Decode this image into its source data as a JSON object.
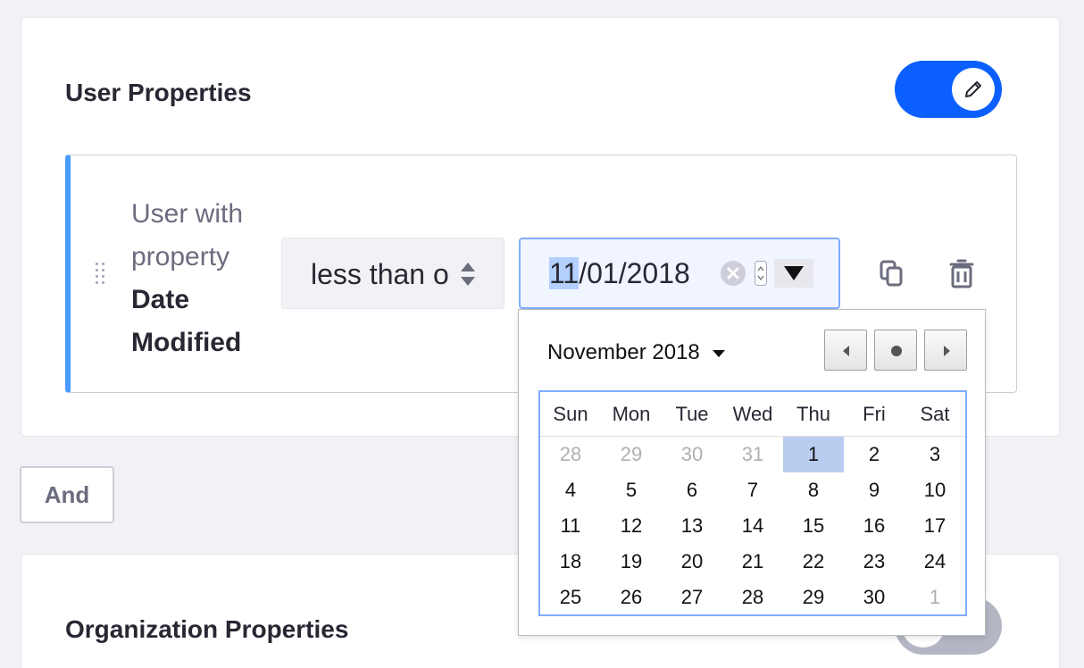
{
  "user_panel": {
    "title": "User Properties",
    "toggle_on": true,
    "criteria": {
      "description_prefix": "User with property",
      "property_name": "Date Modified",
      "operator_value": "less than or equal to",
      "date_value": {
        "month": "11",
        "rest": "/01/2018"
      }
    }
  },
  "conjunction_label": "And",
  "org_panel": {
    "title": "Organization Properties",
    "toggle_on": false
  },
  "datepicker": {
    "month_label": "November 2018",
    "weekdays": [
      "Sun",
      "Mon",
      "Tue",
      "Wed",
      "Thu",
      "Fri",
      "Sat"
    ],
    "weeks": [
      [
        {
          "d": "28",
          "o": true
        },
        {
          "d": "29",
          "o": true
        },
        {
          "d": "30",
          "o": true
        },
        {
          "d": "31",
          "o": true
        },
        {
          "d": "1",
          "s": true
        },
        {
          "d": "2"
        },
        {
          "d": "3"
        }
      ],
      [
        {
          "d": "4"
        },
        {
          "d": "5"
        },
        {
          "d": "6"
        },
        {
          "d": "7"
        },
        {
          "d": "8"
        },
        {
          "d": "9"
        },
        {
          "d": "10"
        }
      ],
      [
        {
          "d": "11"
        },
        {
          "d": "12"
        },
        {
          "d": "13"
        },
        {
          "d": "14"
        },
        {
          "d": "15"
        },
        {
          "d": "16"
        },
        {
          "d": "17"
        }
      ],
      [
        {
          "d": "18"
        },
        {
          "d": "19"
        },
        {
          "d": "20"
        },
        {
          "d": "21"
        },
        {
          "d": "22"
        },
        {
          "d": "23"
        },
        {
          "d": "24"
        }
      ],
      [
        {
          "d": "25"
        },
        {
          "d": "26"
        },
        {
          "d": "27"
        },
        {
          "d": "28"
        },
        {
          "d": "29"
        },
        {
          "d": "30"
        },
        {
          "d": "1",
          "o": true
        }
      ]
    ]
  },
  "colors": {
    "accent": "#0b5fff",
    "criteria_border": "#4b9bff",
    "selected_day": "#b9cdf0"
  },
  "icons": [
    "pencil-icon",
    "drag-handle-icon",
    "select-arrows-icon",
    "clear-icon",
    "spinner-icon",
    "dropdown-arrow-icon",
    "copy-icon",
    "trash-icon",
    "chevron-left-icon",
    "today-dot-icon",
    "chevron-right-icon"
  ]
}
